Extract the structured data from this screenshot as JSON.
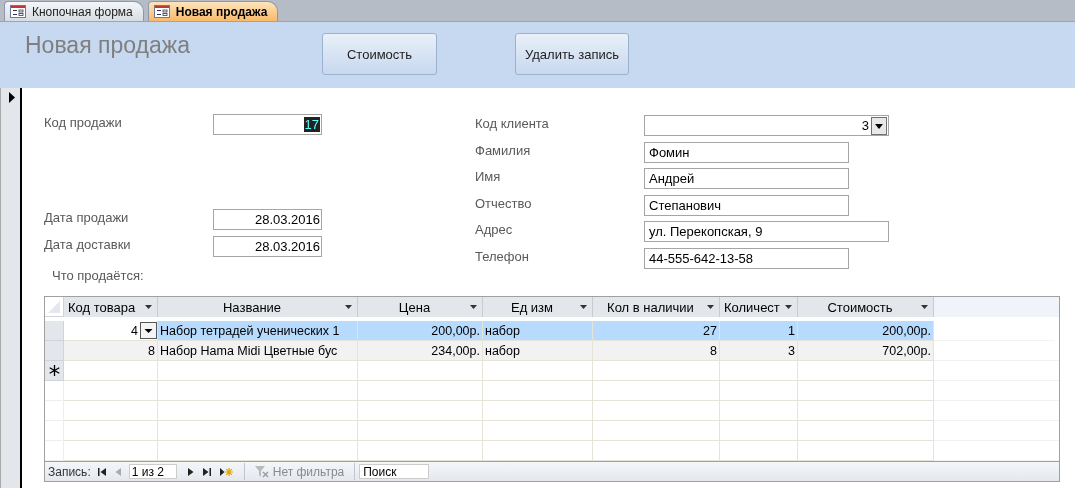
{
  "tabs": [
    {
      "label": "Кнопочная форма",
      "selected": false
    },
    {
      "label": "Новая продажа",
      "selected": true
    }
  ],
  "form": {
    "title": "Новая продажа",
    "buttons": [
      "Стоимость",
      "Удалить запись"
    ]
  },
  "left_fields": [
    {
      "label": "Код продажи",
      "value": "17",
      "focused": true
    },
    {
      "label": "Дата продажи",
      "value": "28.03.2016",
      "focused": false
    },
    {
      "label": "Дата доставки",
      "value": "28.03.2016",
      "focused": false
    }
  ],
  "right_fields": [
    {
      "label": "Код клиента",
      "value": "3",
      "kind": "combo"
    },
    {
      "label": "Фамилия",
      "value": "Фомин",
      "kind": "text"
    },
    {
      "label": "Имя",
      "value": "Андрей",
      "kind": "text"
    },
    {
      "label": "Отчество",
      "value": "Степанович",
      "kind": "text"
    },
    {
      "label": "Адрес",
      "value": "ул. Перекопская, 9",
      "kind": "text"
    },
    {
      "label": "Телефон",
      "value": "44-555-642-13-58",
      "kind": "text"
    }
  ],
  "subform_label": "Что продаётся:",
  "table": {
    "columns": [
      "Код товара",
      "Название",
      "Цена",
      "Ед изм",
      "Кол в наличии",
      "Количест",
      "Стоимость"
    ],
    "rows": [
      {
        "selected": true,
        "cells": [
          "4",
          "Набор тетрадей ученических 1",
          "200,00р.",
          "набор",
          "27",
          "1",
          "200,00р."
        ]
      },
      {
        "selected": false,
        "cells": [
          "8",
          "Набор Hama Midi Цветные бус",
          "234,00р.",
          "набор",
          "8",
          "3",
          "702,00р."
        ]
      }
    ]
  },
  "navigation": {
    "label": "Запись:",
    "position": "1 из 2",
    "filter": "Нет фильтра",
    "search_placeholder": "Поиск"
  }
}
